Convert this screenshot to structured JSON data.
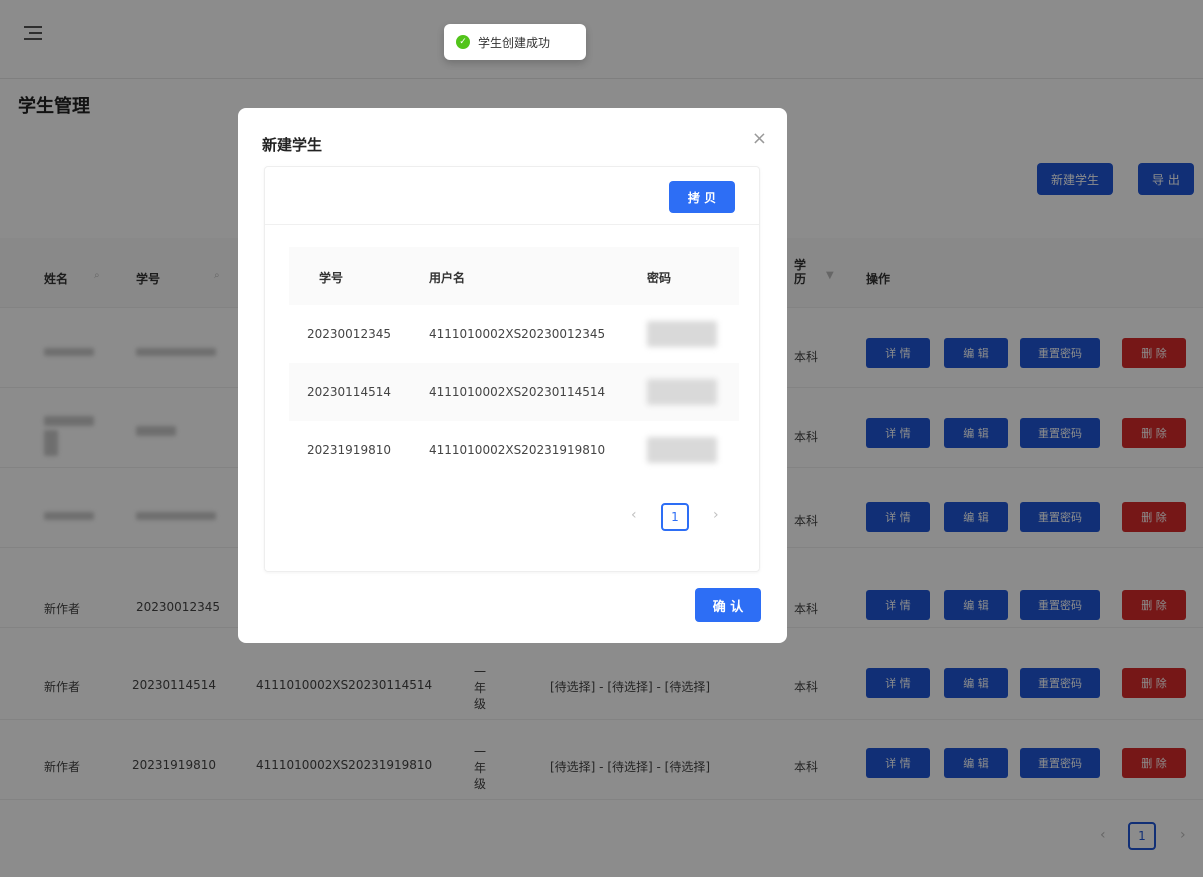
{
  "page": {
    "title": "学生管理"
  },
  "toolbar": {
    "new_label": "新建学生",
    "export_label": "导 出"
  },
  "table": {
    "headers": {
      "name": "姓名",
      "student_id": "学号",
      "grade": "学历",
      "operations": "操作"
    },
    "rows": [
      {
        "name": "",
        "student_id": "",
        "username": "",
        "grade": "",
        "major": "",
        "degree": "本科"
      },
      {
        "name": "",
        "student_id": "",
        "username": "",
        "grade": "",
        "major": "",
        "degree": "本科"
      },
      {
        "name": "",
        "student_id": "",
        "username": "",
        "grade": "",
        "major": "",
        "degree": "本科"
      },
      {
        "name": "新作者",
        "student_id": "20230012345",
        "username": "",
        "grade": "",
        "major": "",
        "degree": "本科"
      },
      {
        "name": "新作者",
        "student_id": "20230114514",
        "username": "4111010002XS20230114514",
        "grade": "一年级",
        "major": "[待选择] - [待选择] - [待选择]",
        "degree": "本科"
      },
      {
        "name": "新作者",
        "student_id": "20231919810",
        "username": "4111010002XS20231919810",
        "grade": "一年级",
        "major": "[待选择] - [待选择] - [待选择]",
        "degree": "本科"
      }
    ],
    "actions": {
      "detail": "详 情",
      "edit": "编 辑",
      "reset": "重置密码",
      "delete": "删 除"
    },
    "pagination": {
      "current": "1",
      "prev": "‹",
      "next": "›"
    }
  },
  "toast": {
    "message": "学生创建成功",
    "icon": "check-circle-icon"
  },
  "modal": {
    "title": "新建学生",
    "close": "×",
    "copy_label": "拷 贝",
    "headers": {
      "student_id": "学号",
      "username": "用户名",
      "password": "密码"
    },
    "rows": [
      {
        "student_id": "20230012345",
        "username": "4111010002XS20230012345"
      },
      {
        "student_id": "20230114514",
        "username": "4111010002XS20230114514"
      },
      {
        "student_id": "20231919810",
        "username": "4111010002XS20231919810"
      }
    ],
    "pagination": {
      "current": "1",
      "prev": "‹",
      "next": "›"
    },
    "confirm_label": "确 认"
  }
}
